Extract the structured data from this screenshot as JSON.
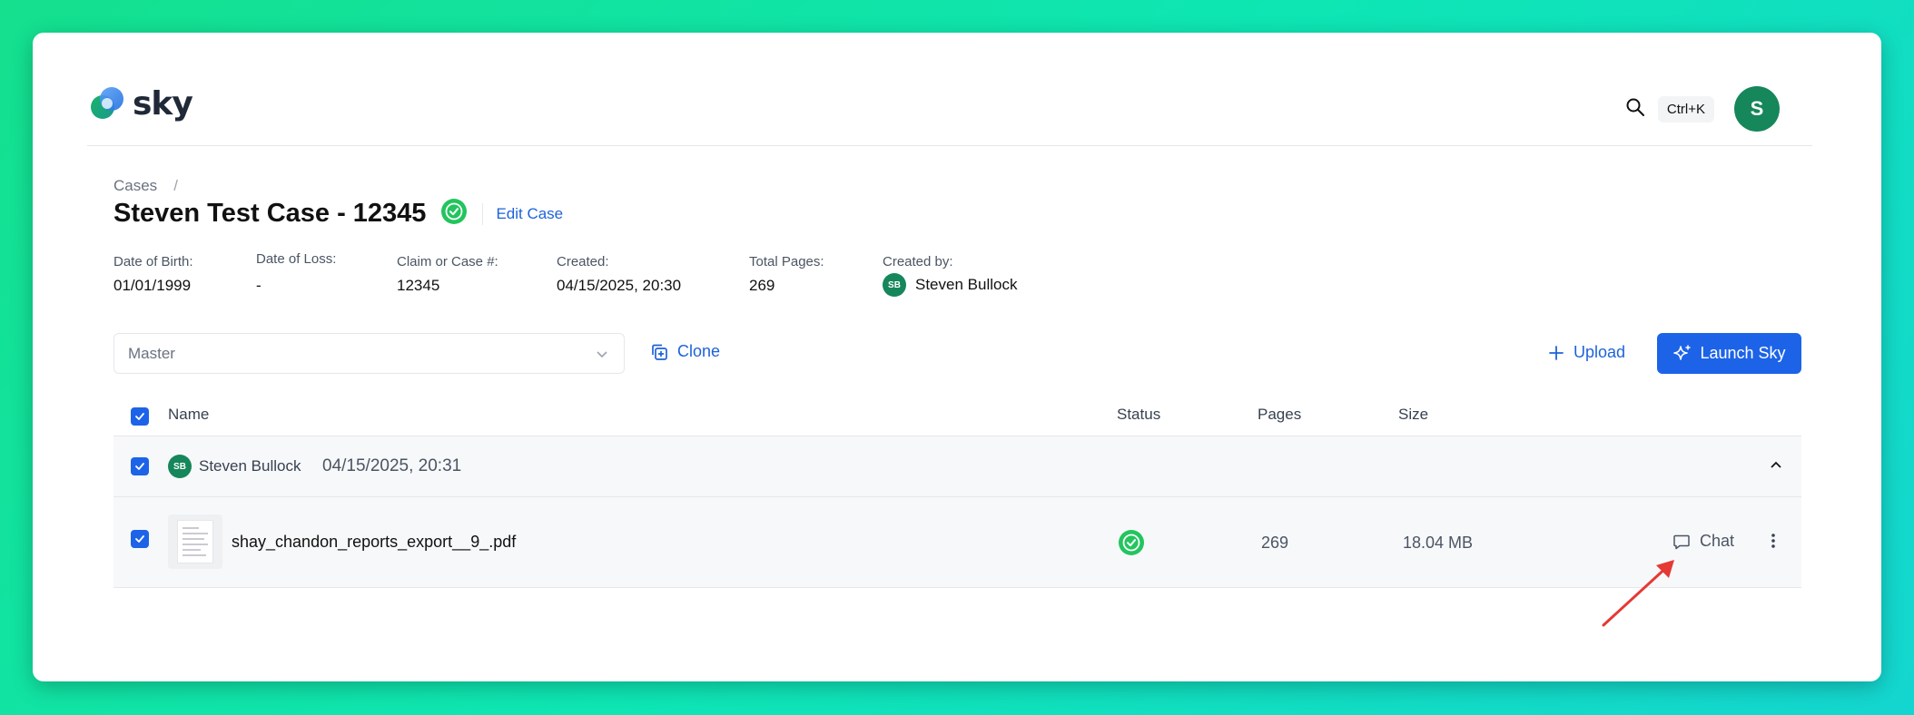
{
  "app": {
    "name": "sky"
  },
  "header": {
    "shortcut": "Ctrl+K",
    "user_initial": "S"
  },
  "breadcrumb": {
    "root": "Cases",
    "separator": "/"
  },
  "case": {
    "title": "Steven Test Case - 12345",
    "edit_label": "Edit Case",
    "fields": [
      {
        "label": "Date of Birth:",
        "value": "01/01/1999"
      },
      {
        "label": "Date of Loss:",
        "value": "-"
      },
      {
        "label": "Claim or Case #:",
        "value": "12345"
      },
      {
        "label": "Created:",
        "value": "04/15/2025, 20:30"
      },
      {
        "label": "Total Pages:",
        "value": "269"
      },
      {
        "label": "Created by:",
        "value": "Steven Bullock",
        "initials": "SB"
      }
    ]
  },
  "toolbar": {
    "version_select": "Master",
    "clone_label": "Clone",
    "upload_label": "Upload",
    "launch_label": "Launch Sky"
  },
  "table": {
    "columns": [
      "Name",
      "Status",
      "Pages",
      "Size"
    ],
    "group": {
      "initials": "SB",
      "user": "Steven Bullock",
      "date": "04/15/2025, 20:31"
    },
    "rows": [
      {
        "name": "shay_chandon_reports_export__9_.pdf",
        "status": "complete",
        "pages": "269",
        "size": "18.04 MB",
        "action": "Chat"
      }
    ]
  },
  "colors": {
    "accent": "#1d63e8",
    "success": "#22c55e",
    "avatar": "#16865b",
    "annotation_arrow": "#e53935"
  }
}
